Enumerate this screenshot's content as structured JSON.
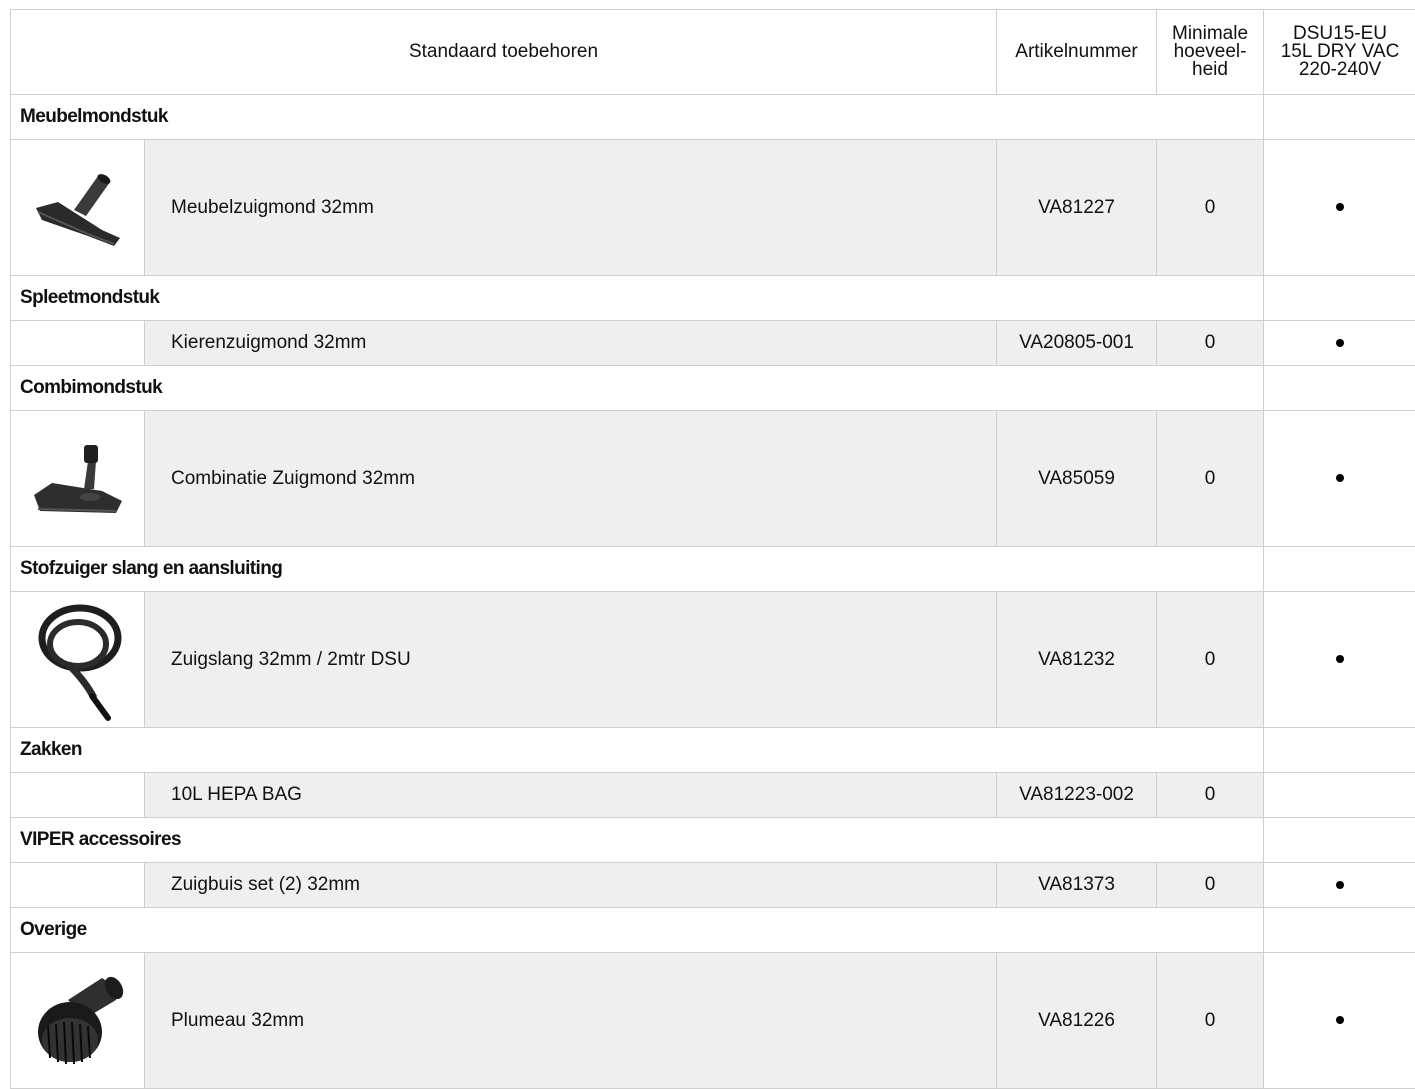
{
  "table": {
    "headers": {
      "main": "Standaard toebehoren",
      "article": "Artikelnummer",
      "min_qty": [
        "Minimale",
        "hoeveel-",
        "heid"
      ],
      "model": [
        "DSU15-EU",
        "15L DRY VAC",
        "220-240V"
      ]
    },
    "groups": [
      {
        "category": "Meubelmondstuk",
        "items": [
          {
            "image_icon": "furniture-nozzle-icon",
            "name": "Meubelzuigmond 32mm",
            "article": "VA81227",
            "min_qty": "0",
            "included": "•"
          }
        ]
      },
      {
        "category": "Spleetmondstuk",
        "items": [
          {
            "image_icon": "",
            "name": "Kierenzuigmond 32mm",
            "article": "VA20805-001",
            "min_qty": "0",
            "included": "•"
          }
        ]
      },
      {
        "category": "Combimondstuk",
        "items": [
          {
            "image_icon": "combination-nozzle-icon",
            "name": "Combinatie Zuigmond 32mm",
            "article": "VA85059",
            "min_qty": "0",
            "included": "•"
          }
        ]
      },
      {
        "category": "Stofzuiger slang en aansluiting",
        "items": [
          {
            "image_icon": "suction-hose-icon",
            "name": "Zuigslang 32mm / 2mtr DSU",
            "article": "VA81232",
            "min_qty": "0",
            "included": "•"
          }
        ]
      },
      {
        "category": "Zakken",
        "items": [
          {
            "image_icon": "",
            "name": "10L HEPA BAG",
            "article": "VA81223-002",
            "min_qty": "0",
            "included": ""
          }
        ]
      },
      {
        "category": "VIPER accessoires",
        "items": [
          {
            "image_icon": "",
            "name": "Zuigbuis set (2) 32mm",
            "article": "VA81373",
            "min_qty": "0",
            "included": "•"
          }
        ]
      },
      {
        "category": "Overige",
        "items": [
          {
            "image_icon": "dusting-brush-icon",
            "name": "Plumeau 32mm",
            "article": "VA81226",
            "min_qty": "0",
            "included": "•"
          }
        ]
      }
    ]
  }
}
